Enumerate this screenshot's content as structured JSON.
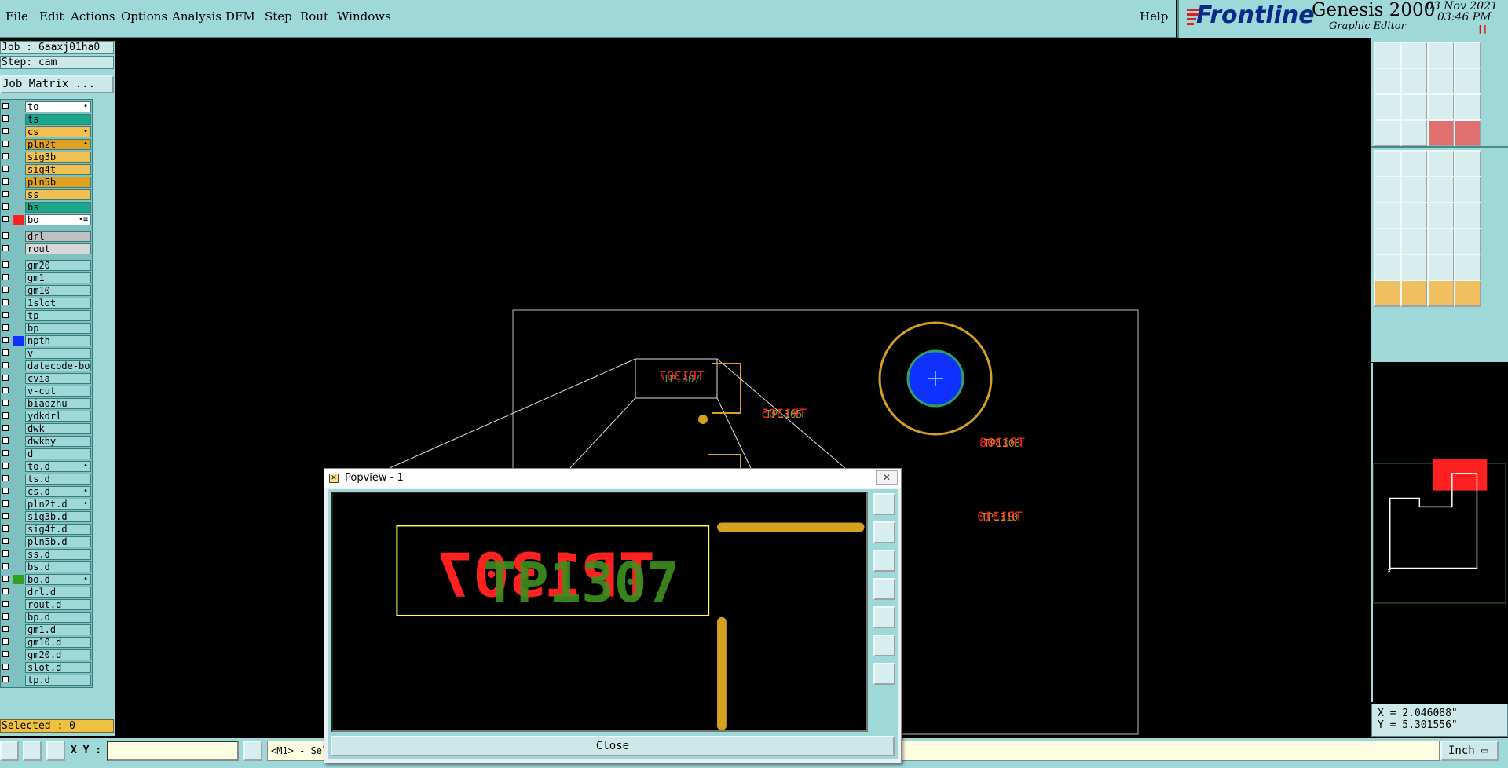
{
  "menu": {
    "file": "File",
    "edit": "Edit",
    "actions": "Actions",
    "options": "Options",
    "analysis": "Analysis",
    "dfm": "DFM",
    "step": "Step",
    "rout": "Rout",
    "windows": "Windows",
    "help": "Help"
  },
  "brand": {
    "logo": "Frontline",
    "app_name": "Genesis 2000",
    "app_sub": "Graphic Editor",
    "date": "03 Nov 2021",
    "time": "03:46 PM"
  },
  "job": {
    "job_label": "Job : 6aaxj01ha0",
    "step_label": "Step: cam",
    "matrix_button": "Job Matrix ..."
  },
  "layers": [
    {
      "name": "to",
      "color": "#ffffff",
      "mark": "•"
    },
    {
      "name": "ts",
      "color": "#1aa88a",
      "mark": ""
    },
    {
      "name": "cs",
      "color": "#f2c050",
      "mark": "•"
    },
    {
      "name": "pln2t",
      "color": "#e0a020",
      "mark": "•"
    },
    {
      "name": "sig3b",
      "color": "#f2c050",
      "mark": ""
    },
    {
      "name": "sig4t",
      "color": "#f2c050",
      "mark": ""
    },
    {
      "name": "pln5b",
      "color": "#e0a020",
      "mark": ""
    },
    {
      "name": "ss",
      "color": "#f2c050",
      "mark": ""
    },
    {
      "name": "bs",
      "color": "#1aa88a",
      "mark": ""
    },
    {
      "name": "bo",
      "color": "#ffffff",
      "mark": "•≡",
      "swatch": "#ff2020"
    },
    {
      "name": "drl",
      "color": "#c0c0c0",
      "mark": ""
    },
    {
      "name": "rout",
      "color": "#d8d8d8",
      "mark": ""
    },
    {
      "name": "gm20",
      "color": "#9fd8d8",
      "mark": ""
    },
    {
      "name": "gm1",
      "color": "#9fd8d8",
      "mark": ""
    },
    {
      "name": "gm10",
      "color": "#9fd8d8",
      "mark": ""
    },
    {
      "name": "1slot",
      "color": "#9fd8d8",
      "mark": ""
    },
    {
      "name": "tp",
      "color": "#9fd8d8",
      "mark": ""
    },
    {
      "name": "bp",
      "color": "#9fd8d8",
      "mark": ""
    },
    {
      "name": "npth",
      "color": "#9fd8d8",
      "mark": "",
      "swatch": "#1030ff"
    },
    {
      "name": "v",
      "color": "#9fd8d8",
      "mark": ""
    },
    {
      "name": "datecode-bo",
      "color": "#9fd8d8",
      "mark": ""
    },
    {
      "name": "cvia",
      "color": "#9fd8d8",
      "mark": ""
    },
    {
      "name": "v-cut",
      "color": "#9fd8d8",
      "mark": ""
    },
    {
      "name": "biaozhu",
      "color": "#9fd8d8",
      "mark": ""
    },
    {
      "name": "ydkdrl",
      "color": "#9fd8d8",
      "mark": ""
    },
    {
      "name": "dwk",
      "color": "#9fd8d8",
      "mark": ""
    },
    {
      "name": "dwkby",
      "color": "#9fd8d8",
      "mark": ""
    },
    {
      "name": "d",
      "color": "#9fd8d8",
      "mark": ""
    },
    {
      "name": "to.d",
      "color": "#9fd8d8",
      "mark": "•"
    },
    {
      "name": "ts.d",
      "color": "#9fd8d8",
      "mark": ""
    },
    {
      "name": "cs.d",
      "color": "#9fd8d8",
      "mark": "•"
    },
    {
      "name": "pln2t.d",
      "color": "#9fd8d8",
      "mark": "•"
    },
    {
      "name": "sig3b.d",
      "color": "#9fd8d8",
      "mark": ""
    },
    {
      "name": "sig4t.d",
      "color": "#9fd8d8",
      "mark": ""
    },
    {
      "name": "pln5b.d",
      "color": "#9fd8d8",
      "mark": ""
    },
    {
      "name": "ss.d",
      "color": "#9fd8d8",
      "mark": ""
    },
    {
      "name": "bs.d",
      "color": "#9fd8d8",
      "mark": ""
    },
    {
      "name": "bo.d",
      "color": "#9fd8d8",
      "mark": "•",
      "swatch": "#30a020"
    },
    {
      "name": "drl.d",
      "color": "#9fd8d8",
      "mark": ""
    },
    {
      "name": "rout.d",
      "color": "#9fd8d8",
      "mark": ""
    },
    {
      "name": "bp.d",
      "color": "#9fd8d8",
      "mark": ""
    },
    {
      "name": "gm1.d",
      "color": "#9fd8d8",
      "mark": ""
    },
    {
      "name": "gm10.d",
      "color": "#9fd8d8",
      "mark": ""
    },
    {
      "name": "gm20.d",
      "color": "#9fd8d8",
      "mark": ""
    },
    {
      "name": "slot.d",
      "color": "#9fd8d8",
      "mark": ""
    },
    {
      "name": "tp.d",
      "color": "#9fd8d8",
      "mark": ""
    }
  ],
  "status": {
    "selected": "Selected : 0",
    "xy_label": "X Y :",
    "xy_value": "",
    "message": "<M1> - Sel",
    "units": "Inch"
  },
  "coords": {
    "x": "X = 2.046088\"",
    "y": "Y = 5.301556\""
  },
  "canvas_labels": {
    "ref_top": "TP1307",
    "ref_mid": "TP1305",
    "ref_right": "TP1308",
    "ref_low": "TP1310"
  },
  "popview": {
    "title": "Popview - 1",
    "close_label": "Close",
    "zoom_text": "TP1307",
    "zoom_text_back": "TP1307"
  },
  "colors": {
    "panel_bg": "#9fd8d8",
    "gold": "#d4a020",
    "red": "#ff2020",
    "green": "#2f8f1f",
    "yellow": "#ffff40",
    "blue_pad": "#1030ff"
  }
}
